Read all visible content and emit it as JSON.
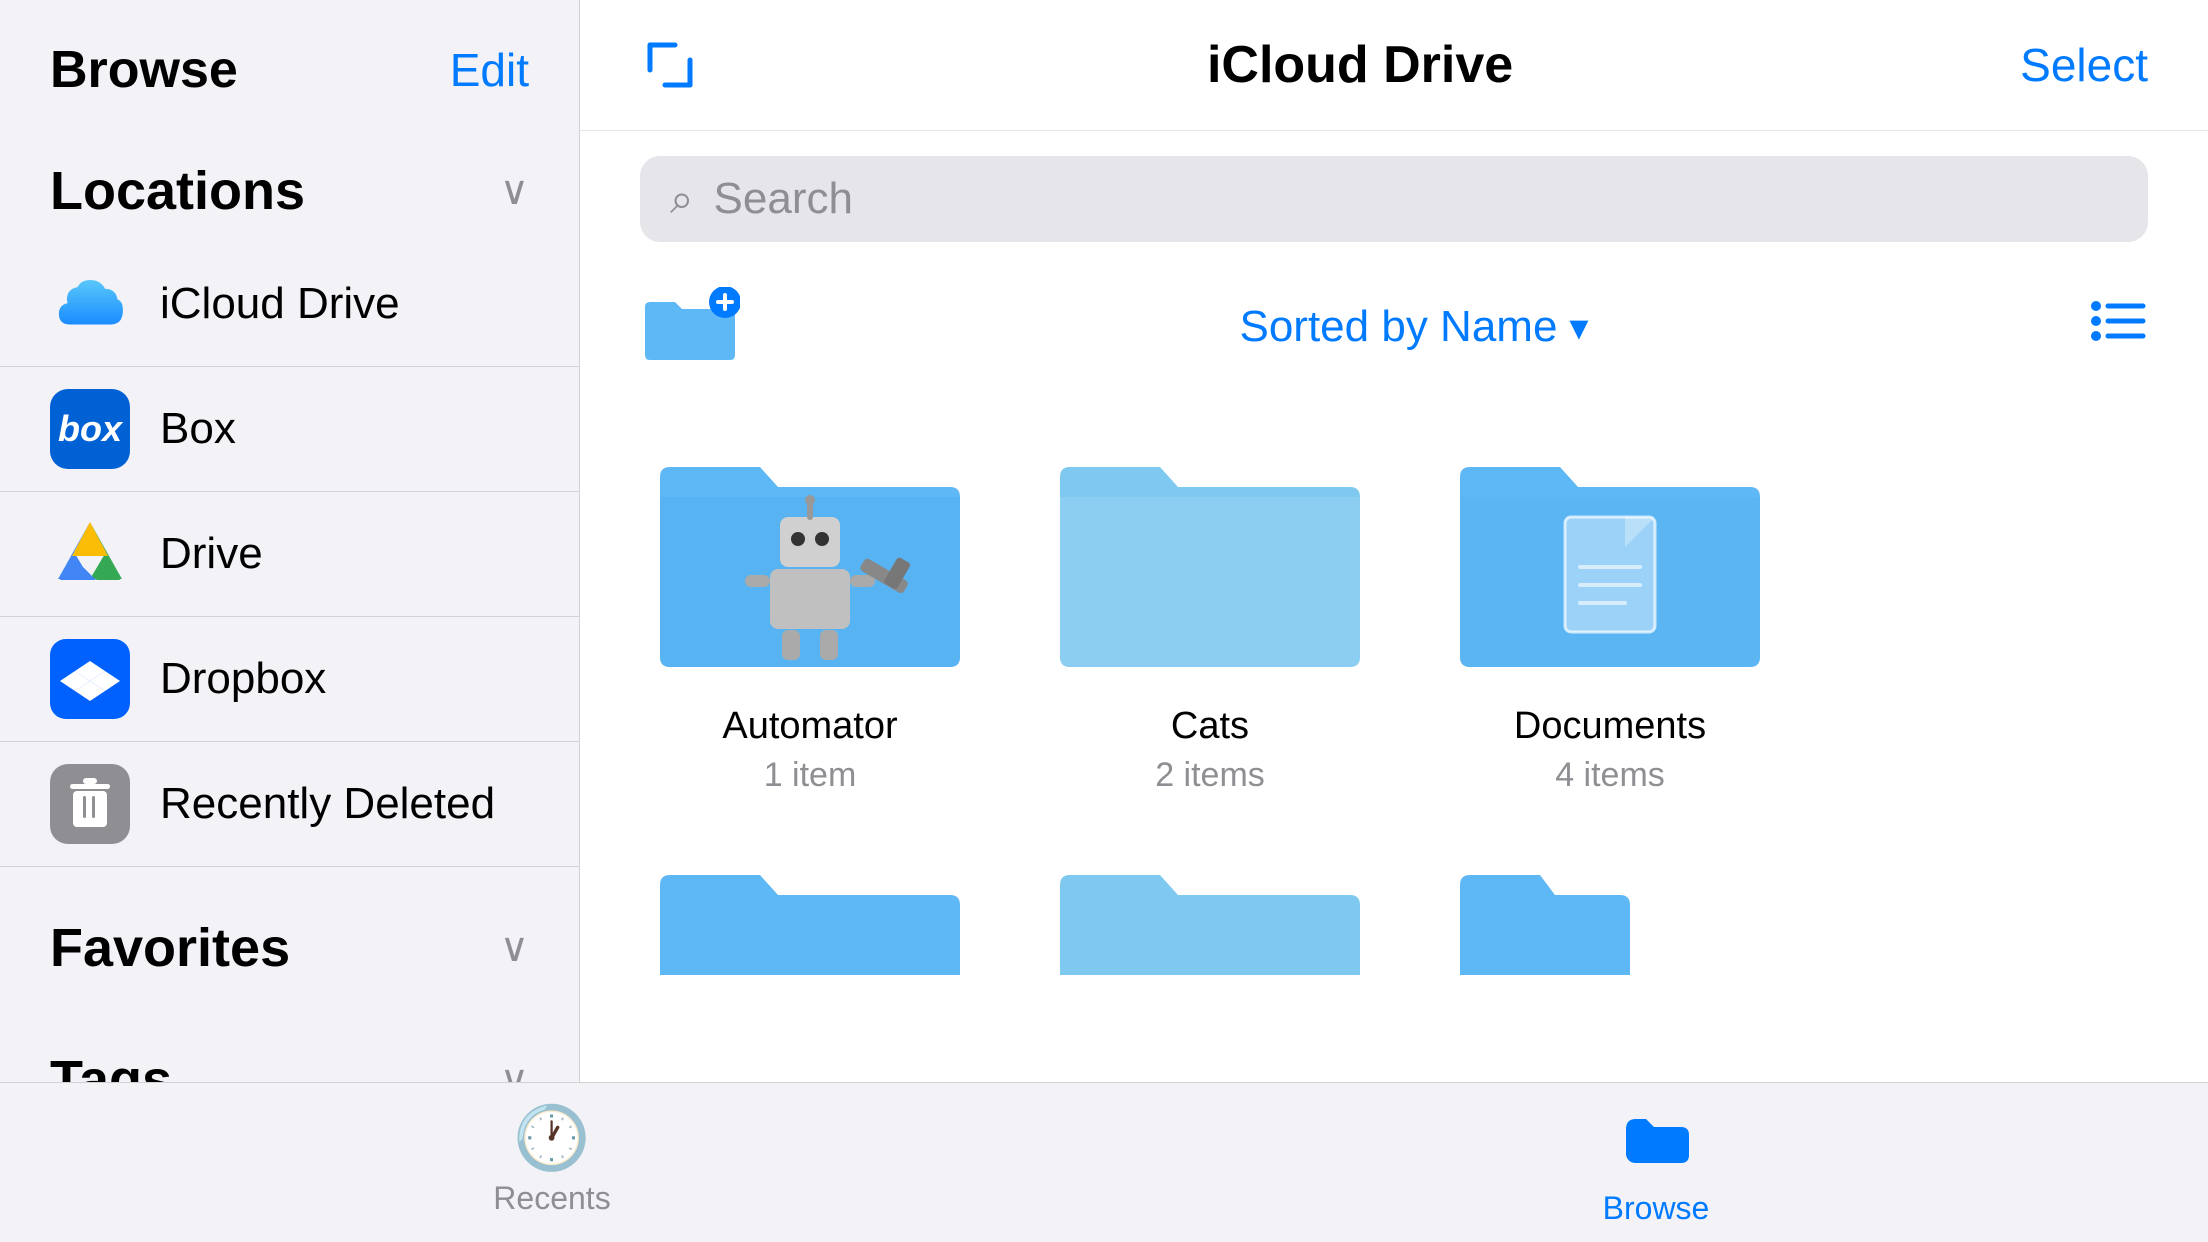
{
  "sidebar": {
    "header_title": "Browse",
    "edit_label": "Edit",
    "sections": {
      "locations": {
        "title": "Locations",
        "items": [
          {
            "id": "icloud-drive",
            "label": "iCloud Drive",
            "icon_type": "icloud"
          },
          {
            "id": "box",
            "label": "Box",
            "icon_type": "box"
          },
          {
            "id": "drive",
            "label": "Drive",
            "icon_type": "gdrive"
          },
          {
            "id": "dropbox",
            "label": "Dropbox",
            "icon_type": "dropbox"
          },
          {
            "id": "recently-deleted",
            "label": "Recently Deleted",
            "icon_type": "trash"
          }
        ]
      },
      "favorites": {
        "title": "Favorites"
      },
      "tags": {
        "title": "Tags"
      }
    }
  },
  "content": {
    "title": "iCloud Drive",
    "select_label": "Select",
    "search_placeholder": "Search",
    "sort_label": "Sorted by Name",
    "folders": [
      {
        "name": "Automator",
        "count": "1 item",
        "type": "automator"
      },
      {
        "name": "Cats",
        "count": "2 items",
        "type": "plain"
      },
      {
        "name": "Documents",
        "count": "4 items",
        "type": "docs"
      }
    ]
  },
  "tabbar": {
    "recents_label": "Recents",
    "browse_label": "Browse"
  },
  "colors": {
    "blue": "#007aff",
    "folder_blue": "#5eb8f5",
    "folder_blue_dark": "#4aa8e8",
    "gray": "#8e8e93",
    "white": "#ffffff"
  }
}
